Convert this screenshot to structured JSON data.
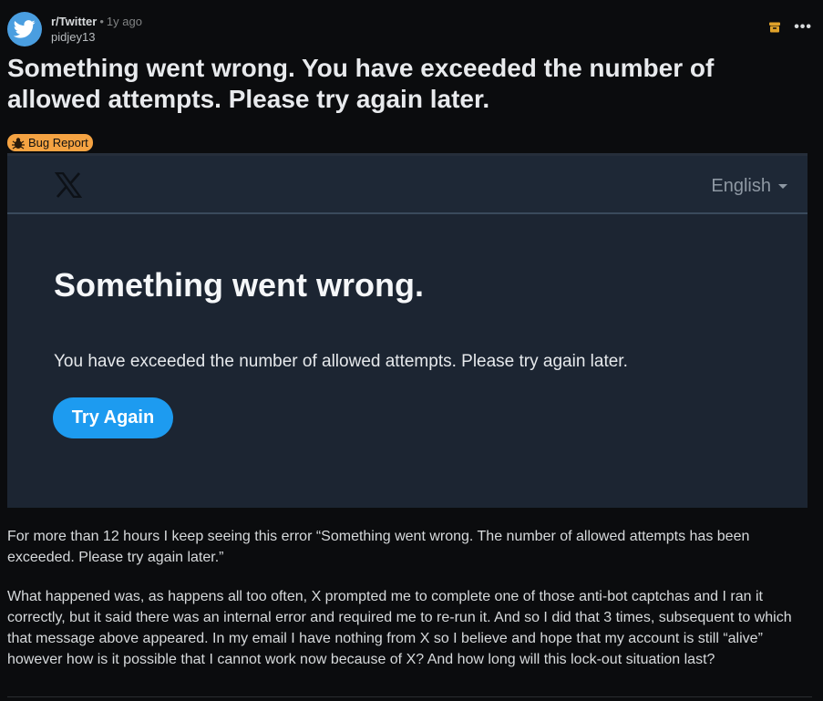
{
  "post": {
    "subreddit": "r/Twitter",
    "separator": "•",
    "time_ago": "1y ago",
    "username": "pidjey13",
    "title": "Something went wrong. You have exceeded the number of allowed attempts. Please try again later.",
    "flair": {
      "label": "Bug Report",
      "icon": "bug-icon",
      "color": "#f5a342"
    },
    "actions": {
      "archive_icon": "archive-icon",
      "more_label": "•••"
    }
  },
  "screenshot": {
    "brand_icon": "x-logo",
    "language": "English",
    "heading": "Something went wrong.",
    "message": "You have exceeded the number of allowed attempts. Please try again later.",
    "button": "Try Again",
    "accent": "#1d9bf0"
  },
  "body": {
    "paragraphs": [
      "For more than 12 hours I keep seeing this error “Something went wrong. The number of allowed attempts has been exceeded. Please try again later.”",
      "What happened was, as happens all too often, X prompted me to complete one of those anti-bot captchas and I ran it correctly, but it said there was an internal error and required me to re-run it. And so I did that 3 times, subsequent to which that message above appeared. In my email I have nothing from X so I believe and hope that my account is still “alive” however how is it possible that I cannot work now because of X? And how long will this lock-out situation last?"
    ]
  }
}
